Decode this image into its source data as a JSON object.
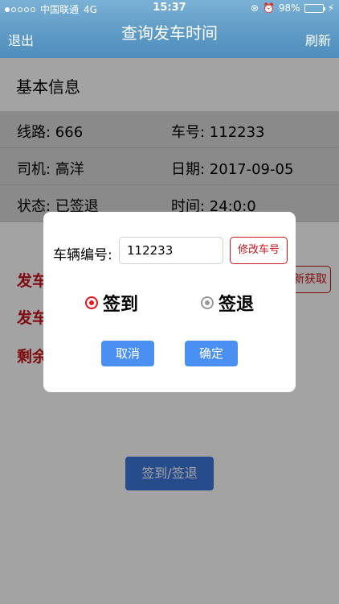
{
  "status_bar": {
    "carrier": "中国联通",
    "network": "4G",
    "time": "15:37",
    "battery": "98%",
    "battery_level": 0.98
  },
  "nav": {
    "back_label": "退出",
    "title": "查询发车时间",
    "refresh_label": "刷新"
  },
  "info": {
    "section_title": "基本信息",
    "route_text": "线路: 666",
    "vehicle_text": "车号: 112233",
    "driver_text": "司机: 高洋",
    "date_text": "日期: 2017-09-05",
    "state_text": "状态: 已签退",
    "time_text": "时间: 24:0:0"
  },
  "partial_lines": [
    "发车",
    "发车",
    "剩余"
  ],
  "refetch_label": "新获取",
  "main_button_label": "签到/签退",
  "modal": {
    "vehicle_label": "车辆编号:",
    "vehicle_value": "112233",
    "edit_button": "修改车号",
    "radio_checkin": "签到",
    "radio_checkout": "签退",
    "selected": "签到",
    "cancel": "取消",
    "confirm": "确定"
  },
  "colors": {
    "nav_blue": "#5f9bc6",
    "alert_red": "#c8141c",
    "primary_blue": "#3c78dc",
    "modal_blue": "#4a90f2"
  }
}
